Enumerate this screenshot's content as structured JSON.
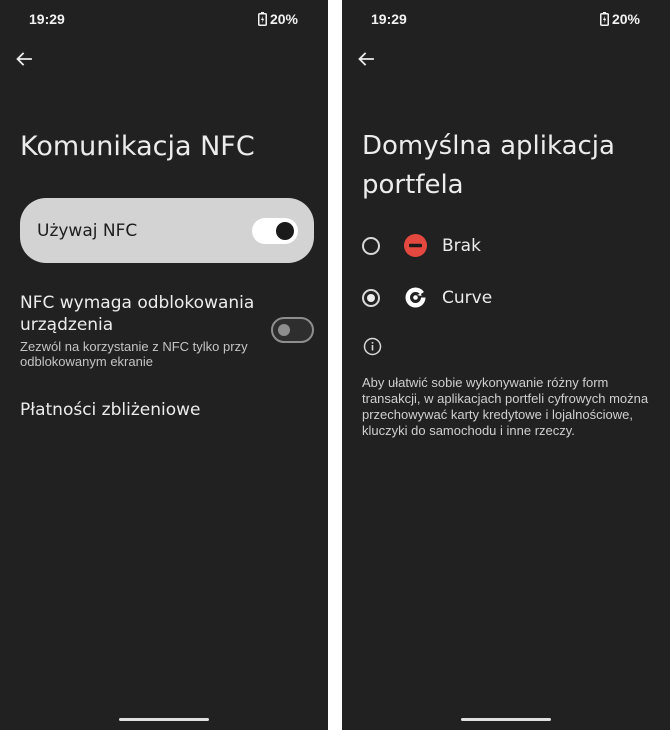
{
  "left": {
    "status": {
      "time": "19:29",
      "battery": "20%"
    },
    "title": "Komunikacja NFC",
    "use_nfc": {
      "label": "Używaj NFC",
      "enabled": true
    },
    "require_unlock": {
      "title": "NFC wymaga odblokowania urządzenia",
      "subtitle": "Zezwól na korzystanie z NFC tylko przy odblokowanym ekranie",
      "enabled": false
    },
    "contactless_label": "Płatności zbliżeniowe"
  },
  "right": {
    "status": {
      "time": "19:29",
      "battery": "20%"
    },
    "title": "Domyślna aplikacja portfela",
    "options": [
      {
        "label": "Brak",
        "icon": "no-entry-icon",
        "selected": false
      },
      {
        "label": "Curve",
        "icon": "curve-app-icon",
        "selected": true
      }
    ],
    "info_text": "Aby ułatwić sobie wykonywanie różny form transakcji, w aplikacjach portfeli cyfrowych można przechowywać karty kredytowe i lojalnościowe, kluczyki do samochodu i inne rzeczy."
  },
  "colors": {
    "background": "#212121",
    "card": "#d3d3d3",
    "brak_icon": "#e5483f",
    "text": "#ececec"
  }
}
